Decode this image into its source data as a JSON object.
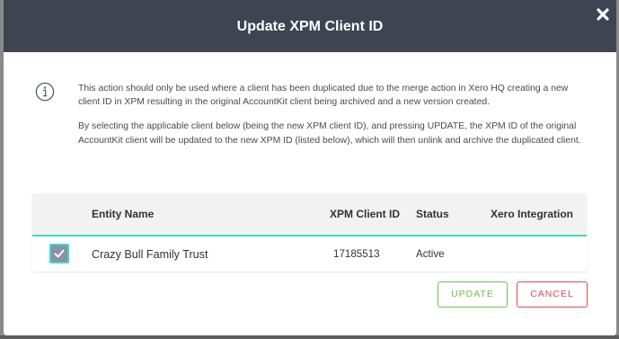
{
  "modal": {
    "title": "Update XPM Client ID",
    "close_icon": "close-icon"
  },
  "info": {
    "icon": "info-icon",
    "paragraph_1": "This action should only be used where a client has been duplicated due to the merge action in Xero HQ creating a new client ID in XPM resulting in the original AccountKit client being archived and a new version created.",
    "paragraph_2": "By selecting the applicable client below (being the new XPM client ID), and pressing UPDATE, the XPM ID of the original AccountKit client will be updated to the new XPM ID (listed below), which will then unlink and archive the duplicated client."
  },
  "table": {
    "columns": {
      "entity_name": "Entity Name",
      "xpm_client_id": "XPM Client ID",
      "status": "Status",
      "xero_integration": "Xero Integration"
    },
    "rows": [
      {
        "checked": true,
        "entity_name": "Crazy Bull Family Trust",
        "xpm_client_id": "17185513",
        "status": "Active",
        "xero_integration": ""
      }
    ]
  },
  "buttons": {
    "update": "UPDATE",
    "cancel": "CANCEL"
  },
  "colors": {
    "header_bg": "#3f4453",
    "accent_teal": "#3fd8c4",
    "update_green": "#6cc24a",
    "cancel_red": "#e3474f",
    "checkbox_fill": "#8a90a8"
  }
}
